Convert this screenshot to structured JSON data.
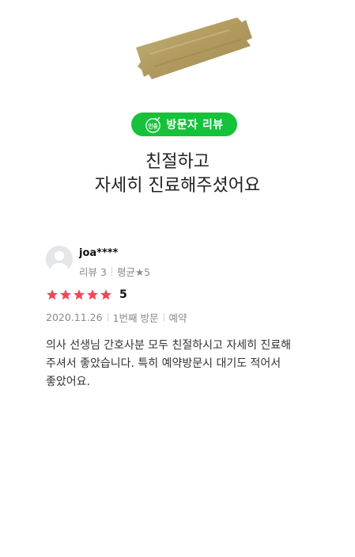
{
  "badge": {
    "icon_text": "인증",
    "label": "방문자 리뷰"
  },
  "headline": {
    "line1": "친절하고",
    "line2": "자세히 진료해주셨어요"
  },
  "reviewer": {
    "name": "joa****",
    "review_count": "리뷰 3",
    "average": "평균★5"
  },
  "rating": {
    "stars": 5,
    "max": 5,
    "value_label": "5",
    "star_color": "#f0485a"
  },
  "visit": {
    "date": "2020.11.26",
    "visit_count": "1번째 방문",
    "type": "예약"
  },
  "review": {
    "lines": [
      "의사 선생님 간호사분 모두 친절하시고 자세히 진료해",
      "주셔서 좋았습니다. 특히 예약방문시 대기도 적어서",
      "좋았어요."
    ]
  },
  "colors": {
    "badge_green": "#15c23a",
    "tape": "#b9a469"
  }
}
